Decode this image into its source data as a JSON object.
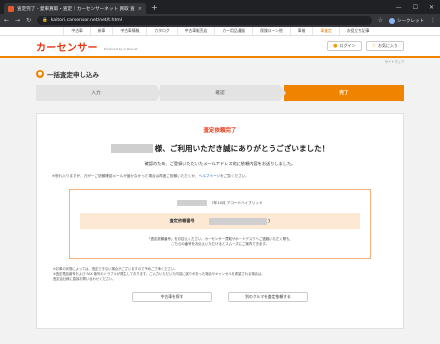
{
  "browser": {
    "tab_title": "査定完了 - 愛車買取・査定｜カーセンサーネット 買取 査定",
    "tab_close": "×",
    "new_tab": "+",
    "window_controls": [
      "—",
      "☐",
      "✕"
    ],
    "url": "kaitori.carsensor.net/net/t.html",
    "profile_label": "シークレット"
  },
  "site": {
    "nav": [
      "中古車",
      "新車",
      "中古車情報",
      "カタログ",
      "中古車販売店",
      "カー用品通販",
      "保険ローン他",
      "車検",
      "車査定",
      "お役立ち記事"
    ],
    "nav_highlight_index": 8,
    "logo": "カーセンサー",
    "logo_sub": "Produced by ◎ Recruit",
    "login_label": "ログイン",
    "favorites_label": "お気に入り",
    "sitemap": "サイトマップ"
  },
  "page": {
    "title": "一括査定申し込み",
    "steps": [
      "入力",
      "確認",
      "完了"
    ],
    "active_step": 2
  },
  "completion": {
    "heading": "査定依頼完了",
    "thanks": "様、ご利用いただき誠にありがとうございました！",
    "confirm": "確認のため、ご登録いただいたメールアドレス宛に依頼内容をお送りしました。",
    "spam_note": "※恐れ入りますが、万が一ご依頼確認メールが届かなかった場合は再度ご依頼いただくか、",
    "help_link": "ヘルプページ",
    "spam_tail": "をご覧ください。",
    "car_info": "7年10月 アコードハイブリッド",
    "request_no_label": "査定依頼番号",
    "request_no_suffix": "7",
    "request_note_1": "「査定依頼番号」をお控えください。カーセンサー買取サポートデスクへご連絡いただく際も、",
    "request_note_2": "こちらの番号をお伝えいただけるとスムーズにご案内できます。",
    "notes": [
      "※お車の状態によっては、査定できない場合がございますので予めご了承ください。",
      "※査定電話番号および FAX 番号のトラブルが発生しております。ご入力いただいた内容に誤りがあった場合やキャンセルを希望される場合は、",
      "査定会社様に直接お問い合わせください。"
    ],
    "button_search": "中古車を探す",
    "button_other": "別のクルマを査定依頼する"
  }
}
